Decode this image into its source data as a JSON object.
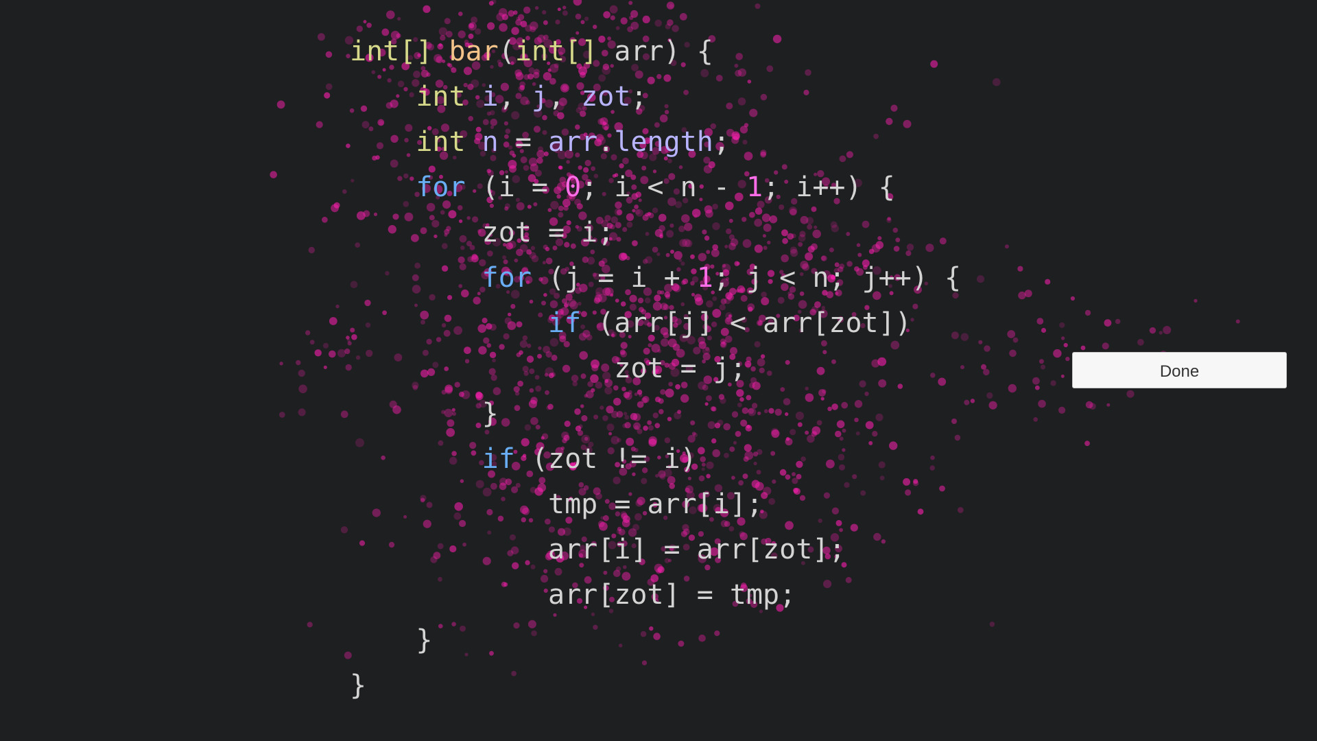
{
  "code": {
    "lines": [
      {
        "indent": 0,
        "tokens": [
          {
            "text": "int[] ",
            "type": "type"
          },
          {
            "text": "bar",
            "type": "func"
          },
          {
            "text": "(",
            "type": "punct"
          },
          {
            "text": "int[] ",
            "type": "type"
          },
          {
            "text": "arr",
            "type": "punct"
          },
          {
            "text": ") {",
            "type": "punct"
          }
        ]
      },
      {
        "indent": 1,
        "tokens": [
          {
            "text": "int ",
            "type": "type"
          },
          {
            "text": "i",
            "type": "var"
          },
          {
            "text": ", ",
            "type": "punct"
          },
          {
            "text": "j",
            "type": "var"
          },
          {
            "text": ", ",
            "type": "punct"
          },
          {
            "text": "zot",
            "type": "var"
          },
          {
            "text": ";",
            "type": "punct"
          }
        ]
      },
      {
        "indent": 1,
        "tokens": [
          {
            "text": "int ",
            "type": "type"
          },
          {
            "text": "n",
            "type": "var"
          },
          {
            "text": " = ",
            "type": "punct"
          },
          {
            "text": "arr",
            "type": "var"
          },
          {
            "text": ".",
            "type": "punct"
          },
          {
            "text": "length",
            "type": "var"
          },
          {
            "text": ";",
            "type": "punct"
          }
        ]
      },
      {
        "indent": 1,
        "tokens": [
          {
            "text": "for",
            "type": "keyword"
          },
          {
            "text": " (i = ",
            "type": "punct"
          },
          {
            "text": "0",
            "type": "number"
          },
          {
            "text": "; i < n - ",
            "type": "punct"
          },
          {
            "text": "1",
            "type": "number"
          },
          {
            "text": "; i++) {",
            "type": "punct"
          }
        ]
      },
      {
        "indent": 2,
        "tokens": [
          {
            "text": "zot = i;",
            "type": "punct"
          }
        ]
      },
      {
        "indent": 2,
        "tokens": [
          {
            "text": "for",
            "type": "keyword"
          },
          {
            "text": " (j = i + ",
            "type": "punct"
          },
          {
            "text": "1",
            "type": "number"
          },
          {
            "text": "; j < n; j++) {",
            "type": "punct"
          }
        ]
      },
      {
        "indent": 3,
        "tokens": [
          {
            "text": "if",
            "type": "keyword"
          },
          {
            "text": " (arr[j] < arr[zot])",
            "type": "punct"
          }
        ]
      },
      {
        "indent": 4,
        "tokens": [
          {
            "text": "zot = j;",
            "type": "punct"
          }
        ]
      },
      {
        "indent": 2,
        "tokens": [
          {
            "text": "}",
            "type": "punct"
          }
        ]
      },
      {
        "indent": 2,
        "tokens": [
          {
            "text": "if",
            "type": "keyword"
          },
          {
            "text": " (zot != i)",
            "type": "punct"
          }
        ]
      },
      {
        "indent": 3,
        "tokens": [
          {
            "text": "tmp = arr[i];",
            "type": "punct"
          }
        ]
      },
      {
        "indent": 3,
        "tokens": [
          {
            "text": "arr[i] = arr[zot];",
            "type": "punct"
          }
        ]
      },
      {
        "indent": 3,
        "tokens": [
          {
            "text": "arr[zot] = tmp;",
            "type": "punct"
          }
        ]
      },
      {
        "indent": 1,
        "tokens": [
          {
            "text": "}",
            "type": "punct"
          }
        ]
      },
      {
        "indent": 0,
        "tokens": [
          {
            "text": "}",
            "type": "punct"
          }
        ]
      }
    ]
  },
  "done_button": {
    "label": "Done"
  },
  "colors": {
    "background": "#1e1f20",
    "type": "#d7d98a",
    "keyword": "#69aef4",
    "function": "#f3c38a",
    "variable": "#b8b4ff",
    "number": "#ff6ee8",
    "punctuation": "#d4d4d4",
    "heatmap": "#ff1fb2",
    "button_background": "#f7f7f7",
    "button_text": "#333333"
  },
  "overlays": {
    "gaze_heatmap": "pink-dots"
  }
}
